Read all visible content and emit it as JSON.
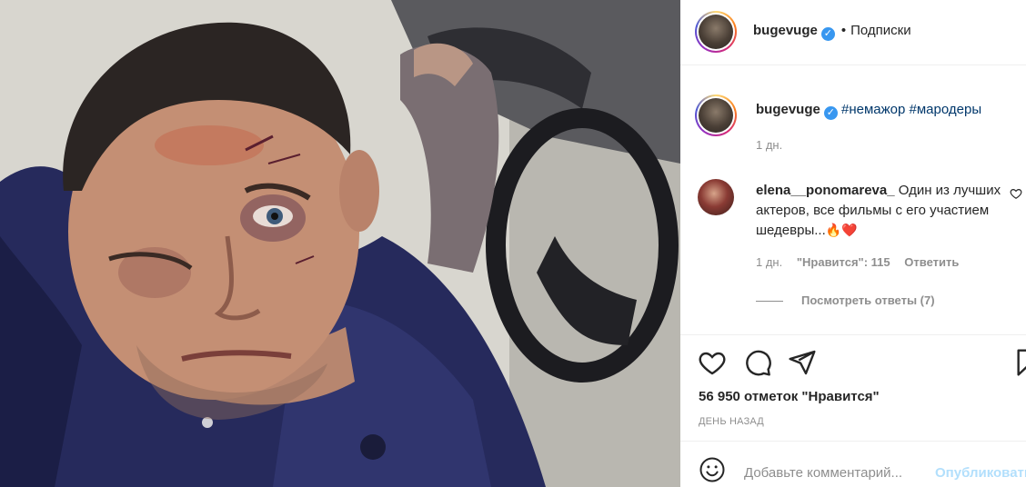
{
  "post": {
    "author": "bugevuge",
    "follow_label": "Подписки",
    "dot": "•",
    "caption_tags": "#немажор #мародеры",
    "caption_time": "1 дн.",
    "likes_text": "56 950 отметок \"Нравится\"",
    "posted_ago": "ДЕНЬ НАЗАД"
  },
  "comment": {
    "author": "elena__ponomareva_",
    "text": "Один из лучших актеров, все фильмы с его участием шедевры...",
    "emoji": "🔥❤️",
    "time": "1 дн.",
    "likes_label": "\"Нравится\": 115",
    "reply_label": "Ответить",
    "view_replies": "Посмотреть ответы (7)"
  },
  "composer": {
    "placeholder": "Добавьте комментарий...",
    "publish_label": "Опубликовать"
  },
  "icons": {
    "like": "heart-icon",
    "comment": "comment-icon",
    "share": "share-icon",
    "save": "bookmark-icon",
    "emoji": "smile-icon",
    "verified": "verified-badge-icon"
  },
  "colors": {
    "verified": "#3897f0",
    "hashtag": "#00376b",
    "muted": "#8e8e8e",
    "publish_disabled": "#b2dffc"
  }
}
